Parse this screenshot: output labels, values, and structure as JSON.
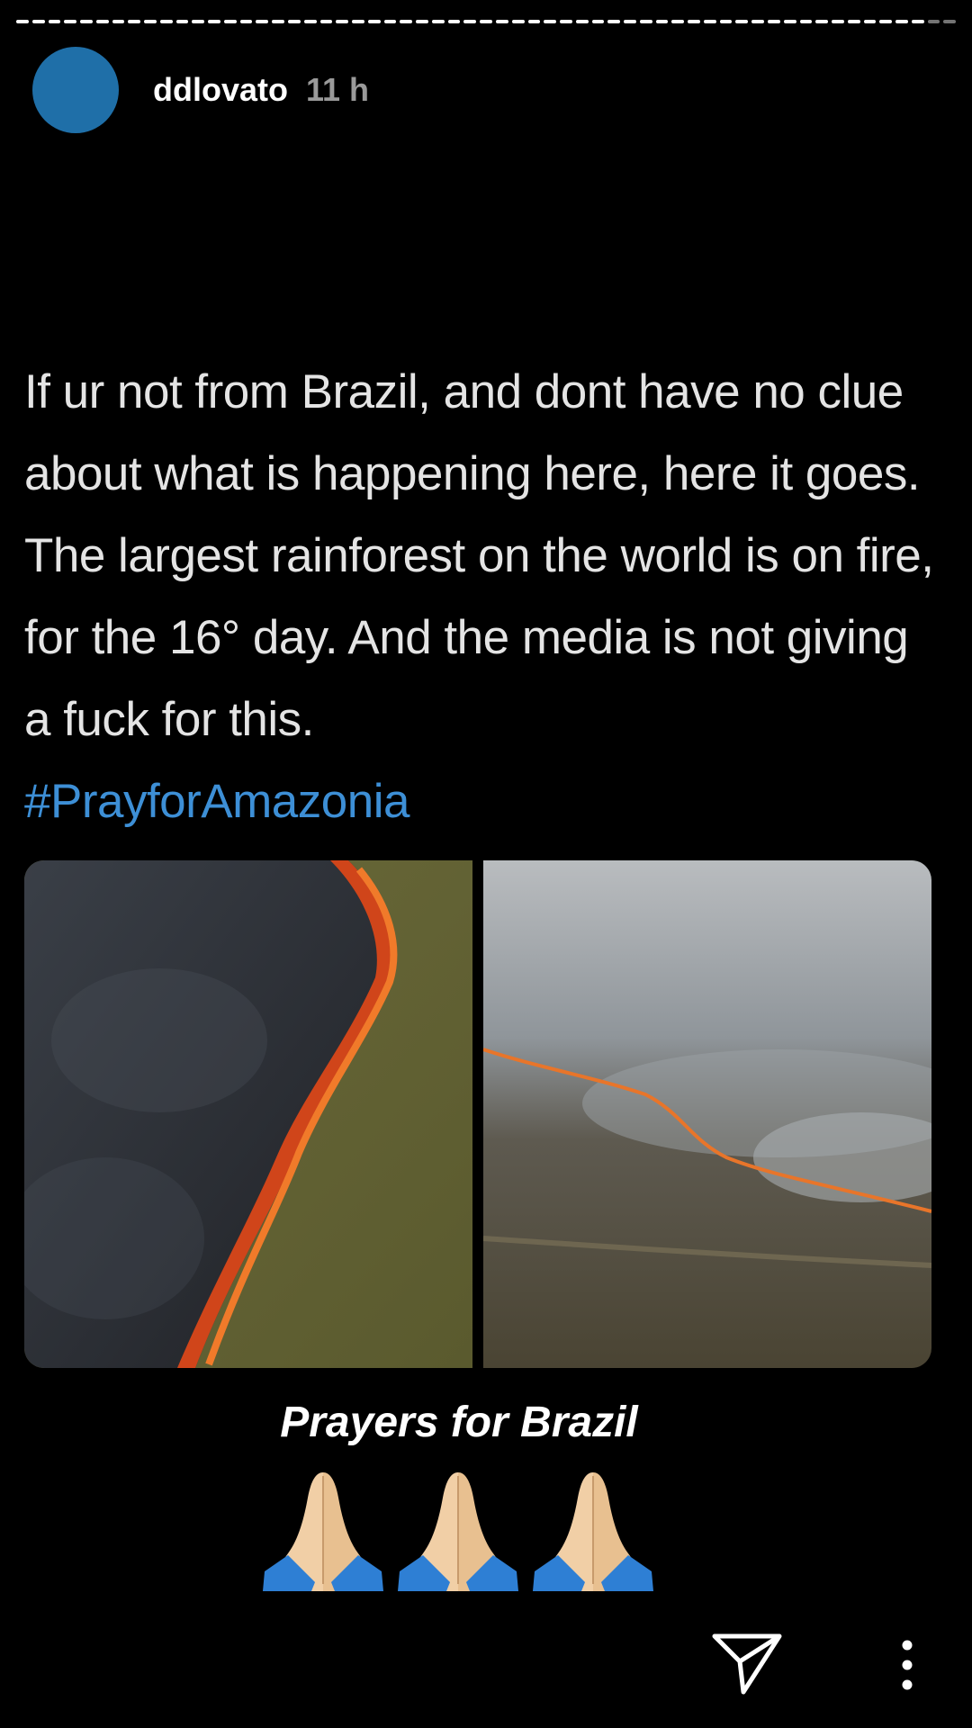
{
  "story": {
    "username": "ddlovato",
    "timestamp": "11 h",
    "progress_segments": [
      1,
      1,
      1,
      1,
      1,
      1,
      1,
      1,
      1,
      1,
      1,
      1,
      1,
      1,
      1,
      1,
      1,
      1,
      1,
      1,
      1,
      1,
      1,
      1,
      1,
      1,
      1,
      1,
      1,
      1,
      1,
      1,
      1,
      1,
      1,
      1,
      1,
      1,
      1,
      1,
      1,
      1,
      1,
      1,
      1,
      1,
      1,
      1,
      1,
      1,
      1,
      1,
      1,
      1,
      1,
      1,
      1,
      0.5,
      0.5
    ],
    "avatar_color": "#1f6fa8"
  },
  "post": {
    "text": "If ur not from Brazil, and dont have no clue about what is happening here, here it goes. The largest rainforest on the world is on fire, for the 16° day. And the media is not giving a fuck for this.",
    "hashtag": "#PrayforAmazonia",
    "hashtag_color": "#3d8fd6"
  },
  "caption": "Prayers for Brazil",
  "emoji": [
    "praying-hands",
    "praying-hands",
    "praying-hands"
  ],
  "actions": {
    "share_icon": "send-icon",
    "more_icon": "more-vertical-icon"
  }
}
